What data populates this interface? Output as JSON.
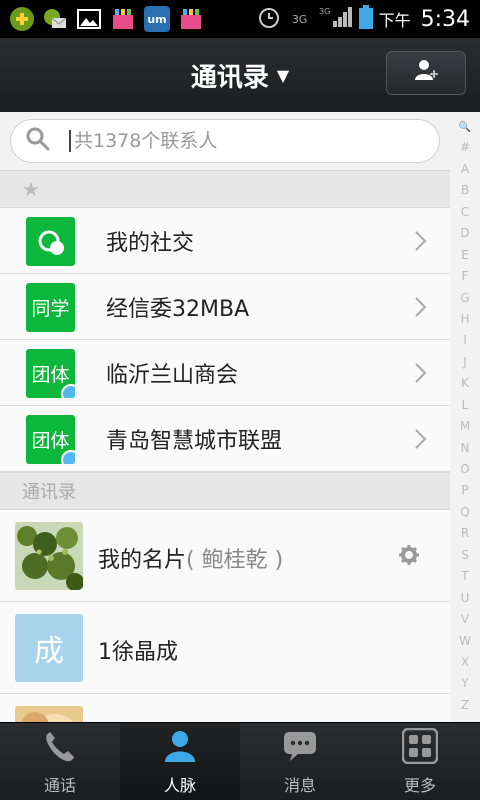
{
  "status_bar": {
    "icons": [
      "plus-circle-icon",
      "envelope-icon",
      "picture-icon",
      "shop-icon",
      "um-app-icon",
      "shop-icon",
      "alarm-icon",
      "3g-icon",
      "3g-signal-icon",
      "battery-icon"
    ],
    "ampm": "下午",
    "time": "5:34"
  },
  "header": {
    "title": "通讯录",
    "dropdown_icon": "triangle-down-icon",
    "add_contact_icon": "add-person-icon"
  },
  "search": {
    "placeholder": "共1378个联系人",
    "icon": "search-icon"
  },
  "favorites_section": {
    "label": "★"
  },
  "groups": [
    {
      "badge": "",
      "icon": "social-icon",
      "label": "我的社交"
    },
    {
      "badge": "同学",
      "label": "经信委32MBA"
    },
    {
      "badge": "团体",
      "label": "临沂兰山商会"
    },
    {
      "badge": "团体",
      "label": "青岛智慧城市联盟"
    }
  ],
  "contacts_section": {
    "label": "通讯录"
  },
  "my_card": {
    "title": "我的名片",
    "owner": "( 鲍桂乾 )",
    "settings_icon": "gear-icon"
  },
  "contacts": [
    {
      "avatar_text": "成",
      "name": "1徐晶成"
    }
  ],
  "alphabet": [
    "🔍",
    "#",
    "A",
    "B",
    "C",
    "D",
    "E",
    "F",
    "G",
    "H",
    "I",
    "J",
    "K",
    "L",
    "M",
    "N",
    "O",
    "P",
    "Q",
    "R",
    "S",
    "T",
    "U",
    "V",
    "W",
    "X",
    "Y",
    "Z"
  ],
  "tabs": [
    {
      "label": "通话",
      "icon": "phone-icon",
      "active": false
    },
    {
      "label": "人脉",
      "icon": "person-icon",
      "active": true
    },
    {
      "label": "消息",
      "icon": "message-icon",
      "active": false
    },
    {
      "label": "更多",
      "icon": "grid-icon",
      "active": false
    }
  ],
  "colors": {
    "group_green": "#0bb83b",
    "accent_blue": "#3fa9e8",
    "header_bg": "#222426"
  }
}
